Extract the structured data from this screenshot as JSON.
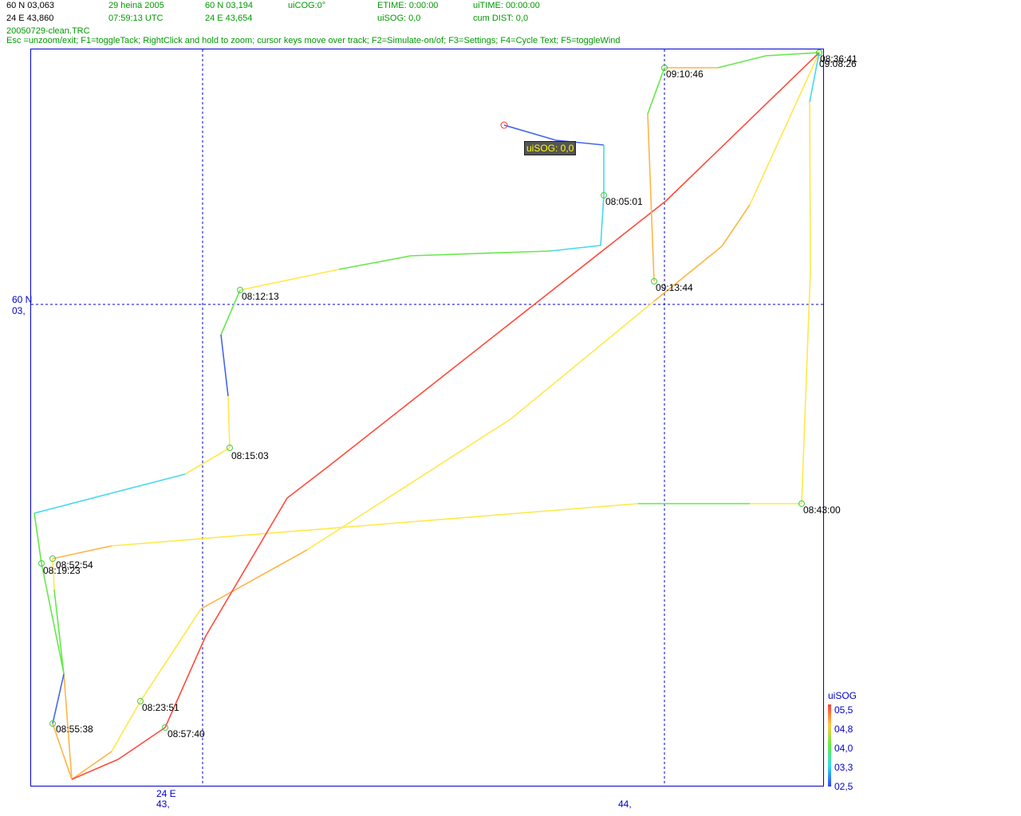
{
  "header": {
    "row1": [
      "60 N 03,063",
      "29 heinä 2005",
      "60 N 03,194",
      "uiCOG:0°",
      "ETIME: 0:00:00",
      "uiTIME: 00:00:00"
    ],
    "row2": [
      "24 E 43,860",
      "07:59:13 UTC",
      "24 E 43,654",
      "",
      "uiSOG: 0,0",
      "cum DIST: 0,0"
    ],
    "filename": "20050729-clean.TRC",
    "help": "Esc =unzoom/exit; F1=toggleTack; RightClick and hold to zoom; cursor keys move over track; F2=Simulate-on/of; F3=Settings; F4=Cycle Text; F5=toggleWind"
  },
  "axes": {
    "lat_label_line1": "60 N",
    "lat_label_line2": "03,",
    "lon_label1_line1": "24 E",
    "lon_label1_line2": "43,",
    "lon_label2": "44,"
  },
  "tooltip": "uiSOG: 0,0",
  "legend": {
    "title": "uiSOG",
    "values": [
      "05,5",
      "04,8",
      "04,0",
      "03,3",
      "02,5"
    ]
  },
  "colors": {
    "frame": "#0000cc",
    "grid": "#0000cc",
    "text_green": "#009900",
    "tooltip_bg": "#555555",
    "tooltip_fg": "#ffff00"
  },
  "waypoints": [
    {
      "label": "08:05:01"
    },
    {
      "label": "08:12:13"
    },
    {
      "label": "08:15:03"
    },
    {
      "label": "08:19:23"
    },
    {
      "label": "08:23:51"
    },
    {
      "label": "08:36:41"
    },
    {
      "label": "09:08:26"
    },
    {
      "label": "09:10:46"
    },
    {
      "label": "09:13:44"
    },
    {
      "label": "08:43:00"
    },
    {
      "label": "08:52:54"
    },
    {
      "label": "08:55:38"
    },
    {
      "label": "08:57:40"
    }
  ]
}
